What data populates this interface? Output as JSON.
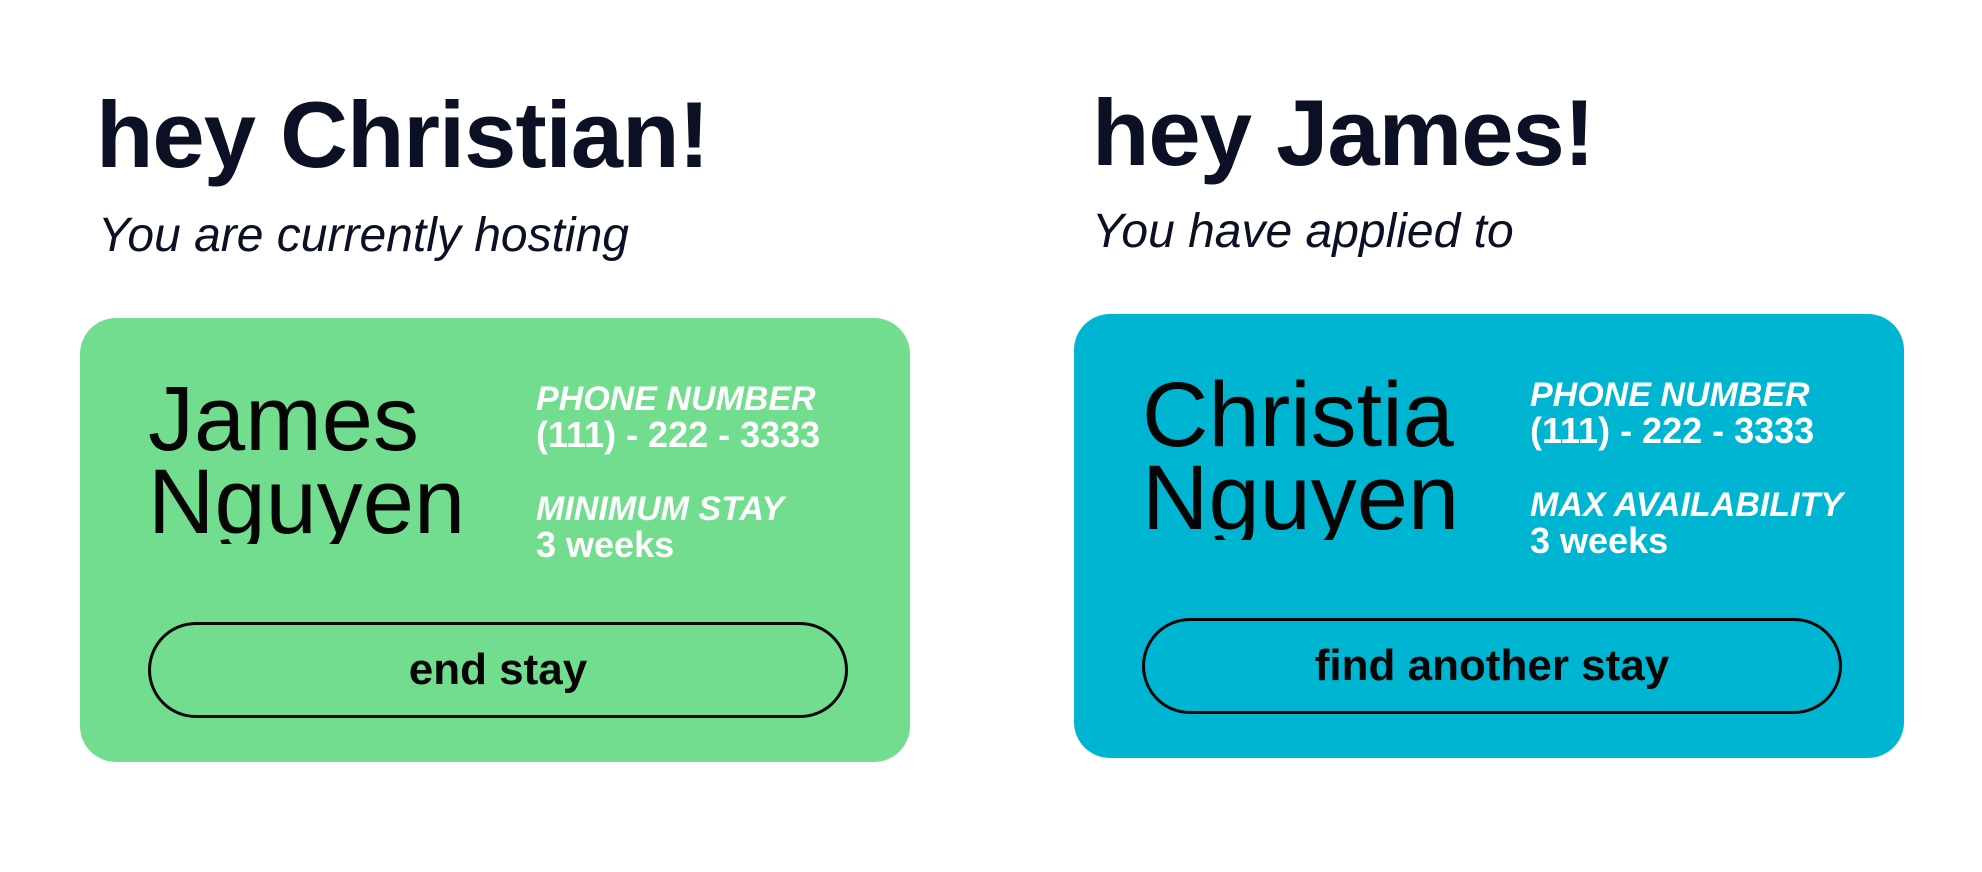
{
  "host_view": {
    "greeting": "hey Christian!",
    "subtitle": "You are currently hosting",
    "card": {
      "background_color": "#72dd8f",
      "name_line1": "James",
      "name_line2": "Nguyen",
      "phone_label": "PHONE NUMBER",
      "phone_value": "(111) - 222 - 3333",
      "stay_label": "MINIMUM STAY",
      "stay_value": "3 weeks",
      "action_label": "end stay"
    }
  },
  "guest_view": {
    "greeting": "hey James!",
    "subtitle": "You have applied to",
    "card": {
      "background_color": "#00b5d1",
      "name_line1": "Christia",
      "name_line2": "Nguyen",
      "phone_label": "PHONE NUMBER",
      "phone_value": "(111) - 222 - 3333",
      "stay_label": "MAX AVAILABILITY",
      "stay_value": "3 weeks",
      "action_label": "find another stay"
    }
  }
}
